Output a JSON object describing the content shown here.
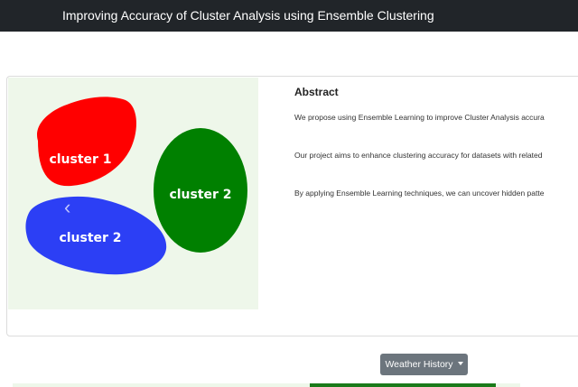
{
  "navbar": {
    "title": "Improving Accuracy of Cluster Analysis using Ensemble Clustering"
  },
  "carousel": {
    "clusters": [
      {
        "label": "cluster 1",
        "color": "#ff0000"
      },
      {
        "label": "cluster 2",
        "color": "#008000"
      },
      {
        "label": "cluster 2",
        "color": "#2c3ff5"
      }
    ],
    "prev_icon": "chevron-left-icon"
  },
  "abstract": {
    "heading": "Abstract",
    "paragraphs": [
      "We propose using Ensemble Learning to improve Cluster Analysis accura",
      "Our project aims to enhance clustering accuracy for datasets with related",
      "By applying Ensemble Learning techniques, we can uncover hidden patte"
    ]
  },
  "dropdown": {
    "label": "Weather History",
    "icon": "caret-down-icon"
  },
  "colors": {
    "navbar_bg": "#212529",
    "carousel_bg": "#eef7ea",
    "button_bg": "#6c757d"
  }
}
